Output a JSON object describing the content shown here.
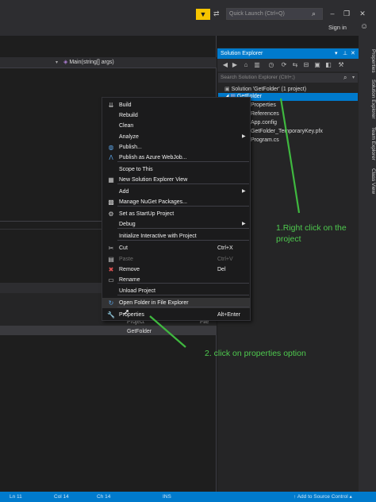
{
  "titlebar": {
    "quick_launch_placeholder": "Quick Launch (Ctrl+Q)",
    "sign_in": "Sign in",
    "minimize": "–",
    "restore": "❐",
    "close": "✕"
  },
  "editor": {
    "nav_method": "Main(string[] args)",
    "col_project": "Project",
    "col_file": "File",
    "getfolder_cell": "GetFolder"
  },
  "solution_explorer": {
    "title": "Solution Explorer",
    "search_placeholder": "Search Solution Explorer (Ctrl+;)",
    "tree": {
      "solution": "Solution 'GetFolder' (1 project)",
      "project": "GetFolder",
      "properties": "Properties",
      "references": "References",
      "appconfig": "App.config",
      "pfx": "GetFolder_TemporaryKey.pfx",
      "program": "Program.cs"
    }
  },
  "side_tabs": [
    "Properties",
    "Solution Explorer",
    "Team Explorer",
    "Class View"
  ],
  "context_menu": [
    {
      "label": "Build",
      "shortcut": "",
      "icon": "build-icon",
      "glyph": "⇊"
    },
    {
      "label": "Rebuild",
      "shortcut": "",
      "icon": "",
      "glyph": ""
    },
    {
      "label": "Clean",
      "shortcut": "",
      "icon": "",
      "glyph": ""
    },
    {
      "label": "Analyze",
      "shortcut": "",
      "icon": "",
      "glyph": "",
      "submenu": true
    },
    {
      "label": "Publish...",
      "shortcut": "",
      "icon": "globe-icon",
      "glyph": "◍"
    },
    {
      "label": "Publish as Azure WebJob...",
      "shortcut": "",
      "icon": "azure-icon",
      "glyph": "Λ"
    },
    {
      "label": "Scope to This",
      "shortcut": "",
      "icon": "",
      "glyph": ""
    },
    {
      "label": "New Solution Explorer View",
      "shortcut": "",
      "icon": "new-view-icon",
      "glyph": "▦"
    },
    {
      "label": "Add",
      "shortcut": "",
      "icon": "",
      "glyph": "",
      "submenu": true
    },
    {
      "label": "Manage NuGet Packages...",
      "shortcut": "",
      "icon": "nuget-icon",
      "glyph": "▩"
    },
    {
      "label": "Set as StartUp Project",
      "shortcut": "",
      "icon": "gear-icon",
      "glyph": "⚙"
    },
    {
      "label": "Debug",
      "shortcut": "",
      "icon": "",
      "glyph": "",
      "submenu": true
    },
    {
      "label": "Initialize Interactive with Project",
      "shortcut": "",
      "icon": "",
      "glyph": ""
    },
    {
      "label": "Cut",
      "shortcut": "Ctrl+X",
      "icon": "scissors-icon",
      "glyph": "✂"
    },
    {
      "label": "Paste",
      "shortcut": "Ctrl+V",
      "icon": "paste-icon",
      "glyph": "▤",
      "disabled": true
    },
    {
      "label": "Remove",
      "shortcut": "Del",
      "icon": "remove-icon",
      "glyph": "✖"
    },
    {
      "label": "Rename",
      "shortcut": "",
      "icon": "rename-icon",
      "glyph": "▭"
    },
    {
      "label": "Unload Project",
      "shortcut": "",
      "icon": "",
      "glyph": ""
    },
    {
      "label": "Open Folder in File Explorer",
      "shortcut": "",
      "icon": "refresh-icon",
      "glyph": "↻"
    },
    {
      "label": "Properties",
      "shortcut": "Alt+Enter",
      "icon": "wrench-icon",
      "glyph": "🔧"
    }
  ],
  "annotations": {
    "note1": "1.Right click on the project",
    "note2": "2. click on properties option"
  },
  "statusbar": {
    "ln": "Ln 11",
    "col": "Col 14",
    "ch": "Ch 14",
    "ins": "INS",
    "source_control": "↑ Add to Source Control ▴"
  },
  "colors": {
    "accent": "#007acc",
    "annotation": "#4ec94e",
    "filter": "#f7c500"
  }
}
